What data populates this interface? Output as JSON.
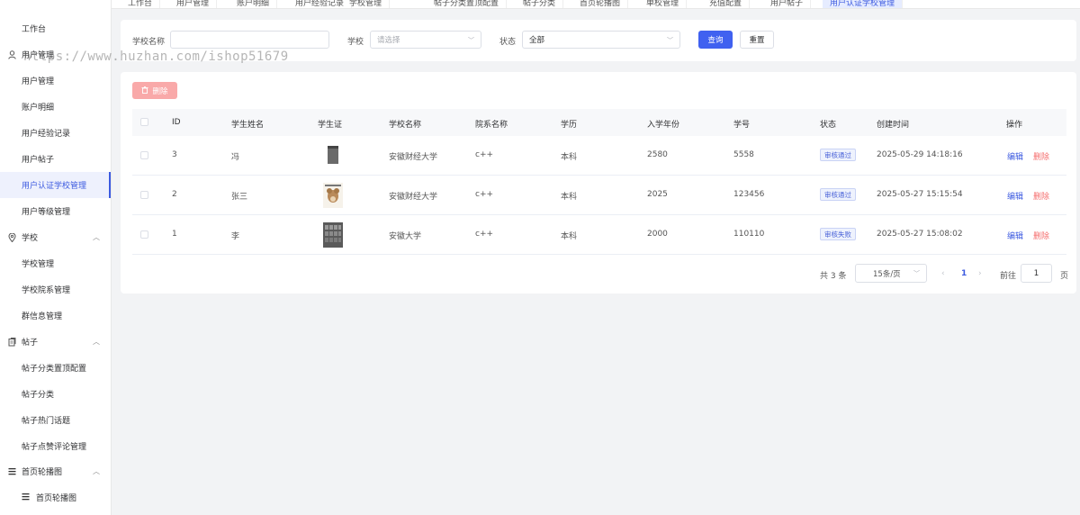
{
  "tabs": [
    "工作台",
    "用户管理",
    "账户明细",
    "用户经验记录",
    "学校管理",
    "帖子分类置顶配置",
    "帖子分类",
    "首页轮播图",
    "单校管理",
    "充值配置",
    "用户帖子",
    "用户认证学校管理"
  ],
  "sidebar": {
    "items": [
      {
        "label": "工作台",
        "type": "item"
      },
      {
        "label": "用户管理",
        "type": "group",
        "icon": "user-icon"
      },
      {
        "label": "用户管理",
        "type": "sub"
      },
      {
        "label": "账户明细",
        "type": "sub"
      },
      {
        "label": "用户经验记录",
        "type": "sub"
      },
      {
        "label": "用户帖子",
        "type": "sub"
      },
      {
        "label": "用户认证学校管理",
        "type": "sub",
        "active": true
      },
      {
        "label": "用户等级管理",
        "type": "sub"
      },
      {
        "label": "学校",
        "type": "group",
        "icon": "location-icon"
      },
      {
        "label": "学校管理",
        "type": "sub"
      },
      {
        "label": "学校院系管理",
        "type": "sub"
      },
      {
        "label": "群信息管理",
        "type": "sub"
      },
      {
        "label": "帖子",
        "type": "group",
        "icon": "document-icon"
      },
      {
        "label": "帖子分类置顶配置",
        "type": "sub"
      },
      {
        "label": "帖子分类",
        "type": "sub"
      },
      {
        "label": "帖子热门话题",
        "type": "sub"
      },
      {
        "label": "帖子点赞评论管理",
        "type": "sub"
      },
      {
        "label": "首页轮播图",
        "type": "group",
        "icon": "menu-icon"
      },
      {
        "label": "首页轮播图",
        "type": "subsub",
        "icon": "menu-icon"
      }
    ]
  },
  "watermark": "https://www.huzhan.com/ishop51679",
  "filters": {
    "school_name_label": "学校名称",
    "school_name_value": "",
    "school_label": "学校",
    "school_placeholder": "请选择",
    "status_label": "状态",
    "status_value": "全部",
    "query_button": "查询",
    "reset_button": "重置"
  },
  "toolbar": {
    "delete_button": "删除"
  },
  "table": {
    "columns": [
      "ID",
      "学生姓名",
      "学生证",
      "学校名称",
      "院系名称",
      "学历",
      "入学年份",
      "学号",
      "状态",
      "创建时间",
      "操作"
    ],
    "rows": [
      {
        "id": "3",
        "name": "冯",
        "school": "安徽财经大学",
        "dept": "c++",
        "edu": "本科",
        "year": "2580",
        "student_no": "5558",
        "status": "审核通过",
        "created": "2025-05-29 14:18:16",
        "edit": "编辑",
        "delete": "删除"
      },
      {
        "id": "2",
        "name": "张三",
        "school": "安徽财经大学",
        "dept": "c++",
        "edu": "本科",
        "year": "2025",
        "student_no": "123456",
        "status": "审核通过",
        "created": "2025-05-27 15:15:54",
        "edit": "编辑",
        "delete": "删除"
      },
      {
        "id": "1",
        "name": "李",
        "school": "安徽大学",
        "dept": "c++",
        "edu": "本科",
        "year": "2000",
        "student_no": "110110",
        "status": "审核失败",
        "created": "2025-05-27 15:08:02",
        "edit": "编辑",
        "delete": "删除"
      }
    ]
  },
  "pagination": {
    "total": "共 3 条",
    "page_size": "15条/页",
    "current": "1",
    "goto_label": "前往",
    "goto_value": "1",
    "page_label": "页"
  },
  "colors": {
    "primary": "#4061f0",
    "danger": "#f56c6c",
    "delete_disabled": "#f9a9a9"
  }
}
